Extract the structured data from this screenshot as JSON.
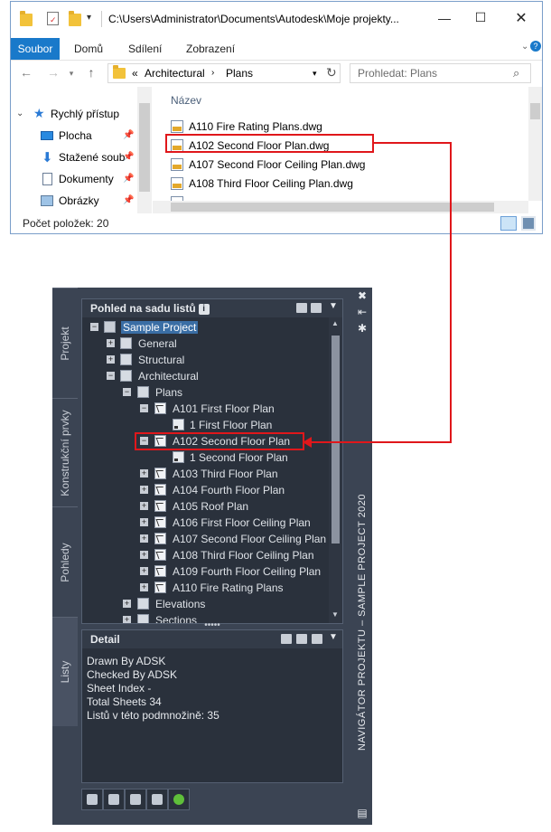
{
  "explorer": {
    "title": "C:\\Users\\Administrator\\Documents\\Autodesk\\Moje projekty...",
    "ribbon_tabs": [
      "Soubor",
      "Domů",
      "Sdílení",
      "Zobrazení"
    ],
    "address_prefix": "«",
    "address": [
      "Architectural",
      "Plans"
    ],
    "search_placeholder": "Prohledat: Plans",
    "nav_items": [
      "Rychlý přístup",
      "Plocha",
      "Stažené soub",
      "Dokumenty",
      "Obrázky"
    ],
    "column_header": "Název",
    "files": [
      "A110 Fire Rating Plans.dwg",
      "A102 Second Floor Plan.dwg",
      "A107 Second Floor Ceiling Plan.dwg",
      "A108 Third Floor Ceiling Plan.dwg"
    ],
    "status": "Počet položek: 20"
  },
  "palette": {
    "left_tabs": [
      "Projekt",
      "Konstrukční prvky",
      "Pohledy",
      "Listy"
    ],
    "sheet_header": "Pohled na sadu listů",
    "info_glyph": "i",
    "tree": {
      "root": "Sample Project",
      "general": "General",
      "structural": "Structural",
      "architectural": "Architectural",
      "plans": "Plans",
      "a101": "A101 First Floor Plan",
      "a101_view": "1 First Floor Plan",
      "a102": "A102 Second Floor Plan",
      "a102_view": "1 Second Floor Plan",
      "a103": "A103 Third Floor Plan",
      "a104": "A104 Fourth Floor Plan",
      "a105": "A105 Roof Plan",
      "a106": "A106 First Floor Ceiling Plan",
      "a107": "A107 Second Floor Ceiling Plan",
      "a108": "A108 Third Floor Ceiling Plan",
      "a109": "A109 Fourth Floor Ceiling Plan",
      "a110": "A110 Fire Rating Plans",
      "elevations": "Elevations",
      "sections": "Sections"
    },
    "detail_header": "Detail",
    "detail_lines": [
      "Drawn By ADSK",
      "Checked By ADSK",
      "Sheet Index -",
      "Total Sheets 34",
      "Listů v této podmnožině: 35"
    ],
    "side_label": "NAVIGÁTOR PROJEKTU – SAMPLE PROJECT 2020"
  }
}
